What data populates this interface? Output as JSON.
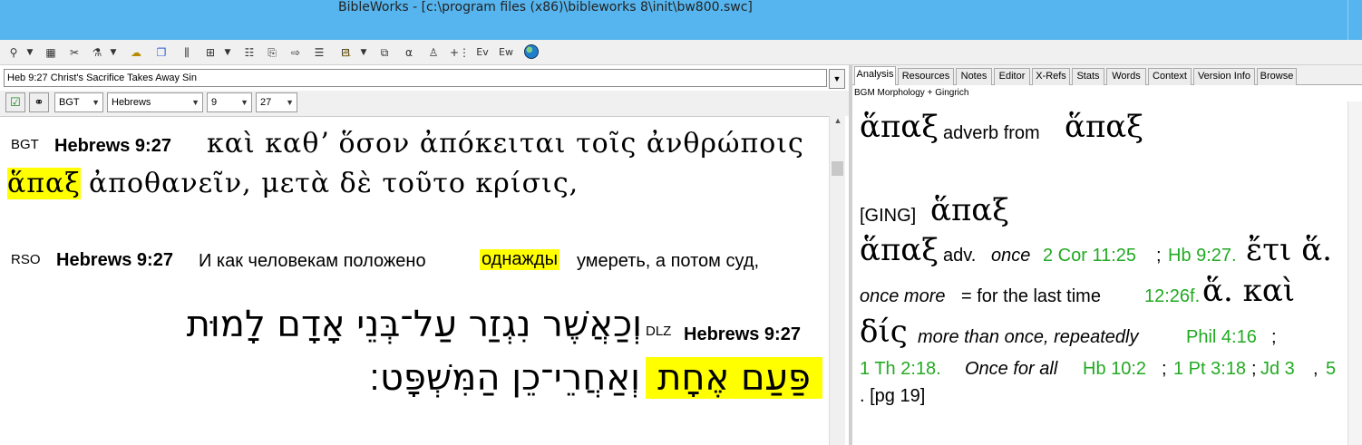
{
  "window": {
    "title": "BibleWorks - [c:\\program files (x86)\\bibleworks 8\\init\\bw800.swc]"
  },
  "toolbar": {
    "icons": [
      "search-icon",
      "dropdown-arrow",
      "version-icon",
      "tools-icon",
      "analysis-icon",
      "dropdown-arrow",
      "highlight-icon",
      "windows-icon",
      "interlinear-icon",
      "layout-icon",
      "dropdown-arrow",
      "columns-icon",
      "copy-icon",
      "export-icon",
      "parallel-icon",
      "editor-icon",
      "highlight2-icon",
      "dropdown-arrow",
      "fit-icon",
      "alpha-icon",
      "person-icon",
      "add-icon",
      "ev-icon",
      "ew-icon",
      "globe-icon"
    ]
  },
  "left": {
    "verse_title": "Heb 9:27 Christ's Sacrifice Takes Away Sin",
    "version_select": "BGT",
    "book_select": "Hebrews",
    "chapter_select": "9",
    "verse_select": "27",
    "passages": [
      {
        "version": "BGT",
        "ref": "Hebrews 9:27",
        "line1": "καὶ καθʼ ὅσον ἀπόκειται τοῖς ἀνθρώποις",
        "hl": "ἅπαξ",
        "line2": "ἀποθανεῖν, μετὰ δὲ τοῦτο κρίσις,"
      },
      {
        "version": "RSO",
        "ref": "Hebrews 9:27",
        "pre": "И как человекам положено",
        "hl": "однажды",
        "post": "умереть, а потом суд,"
      },
      {
        "version": "DLZ",
        "ref": "Hebrews 9:27",
        "line1": "וְכַאֲשֶׁר נִגְזַר עַל־בְּנֵי אָדָם לָמוּת",
        "hl": "פַּעַם אֶחָת",
        "line2": "וְאַחֲרֵי־כֵן הַמִּשְׁפָּט׃"
      }
    ]
  },
  "right": {
    "tabs": [
      "Analysis",
      "Resources",
      "Notes",
      "Editor",
      "X-Refs",
      "Stats",
      "Words",
      "Context",
      "Version Info",
      "Browse"
    ],
    "active_tab": "Analysis",
    "module_label": "BGM Morphology + Gingrich",
    "headword": "ἅπαξ",
    "headword_desc": "adverb from",
    "lemma": "ἅπαξ",
    "ging_tag": "[GING]",
    "ging_word": "ἅπαξ",
    "entry": {
      "word": "ἅπαξ",
      "pos": "adv.",
      "gloss1": "once",
      "ref1": "2 Cor 11:25",
      "sep1": ";",
      "ref2": "Hb 9:27.",
      "greek1": "ἔτι ἅ.",
      "gloss2": "once more",
      "eq": "= for the last time",
      "ref3": "12:26f.",
      "greek2": "ἅ. καὶ",
      "greek3": "δίς",
      "gloss3": "more than once, repeatedly",
      "ref4": "Phil 4:16",
      "sep2": ";",
      "ref5": "1 Th 2:18.",
      "gloss4": "Once for all",
      "ref6": "Hb 10:2",
      "sep3": ";",
      "ref7": "1 Pt 3:18",
      "sep4": ";",
      "ref8": "Jd 3",
      "sep5": ",",
      "ref9": "5",
      "page": ". [pg 19]"
    }
  }
}
